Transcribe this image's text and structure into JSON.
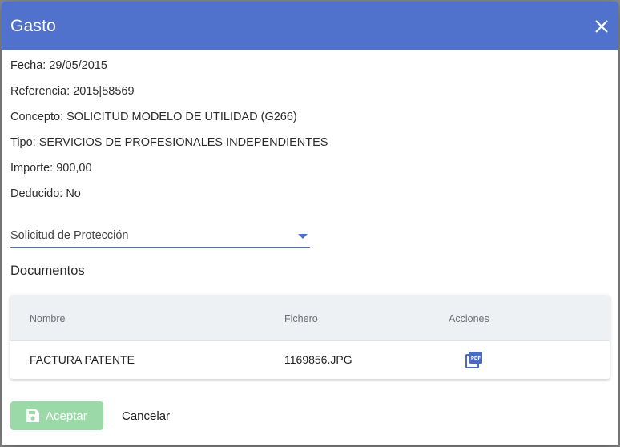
{
  "dialog": {
    "title": "Gasto",
    "close_icon": "close-icon"
  },
  "details": {
    "fecha": "Fecha: 29/05/2015",
    "referencia": "Referencia: 2015|58569",
    "concepto": "Concepto: SOLICITUD MODELO DE UTILIDAD (G266)",
    "tipo": "Tipo: SERVICIOS DE PROFESIONALES INDEPENDIENTES",
    "importe": "Importe: 900,00",
    "deducido": "Deducido: No"
  },
  "select": {
    "value": "Solicitud de Protección"
  },
  "documents": {
    "title": "Documentos",
    "columns": [
      "Nombre",
      "Fichero",
      "Acciones"
    ],
    "rows": [
      {
        "nombre": "FACTURA PATENTE",
        "fichero": "1169856.JPG",
        "action_icon": "pdf-icon"
      }
    ]
  },
  "buttons": {
    "accept": "Aceptar",
    "cancel": "Cancelar"
  },
  "colors": {
    "header": "#5072cc",
    "accept_button": "#9bd9a8",
    "accent": "#5072cc"
  }
}
